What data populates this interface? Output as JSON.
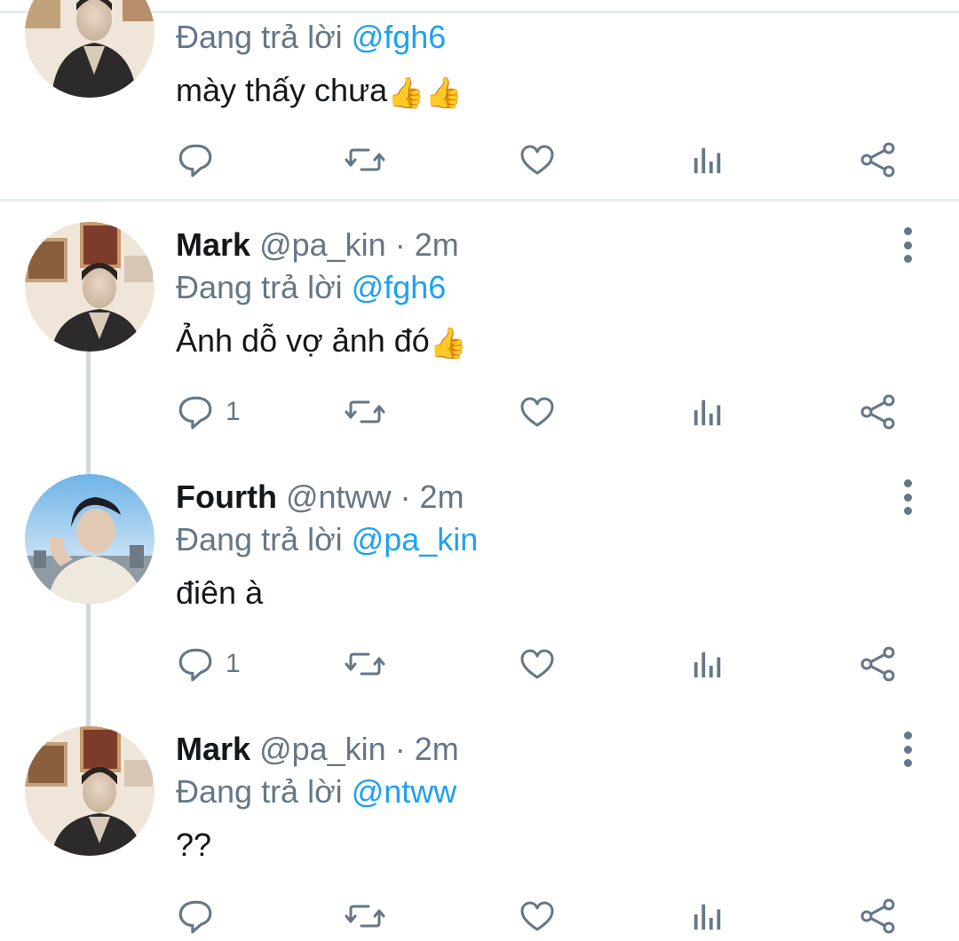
{
  "colors": {
    "accent": "#1da1f2",
    "muted": "#657786",
    "text": "#14171a",
    "line": "#cfd9de"
  },
  "tweets": [
    {
      "reply_prefix": "Đang trả lời ",
      "reply_to": "@fgh6",
      "text": "mày thấy chưa",
      "emoji": "👍👍",
      "reply_count": ""
    },
    {
      "name": "Mark",
      "handle": "@pa_kin",
      "time": " · 2m",
      "reply_prefix": "Đang trả lời ",
      "reply_to": "@fgh6",
      "text": "Ảnh dỗ vợ ảnh đó",
      "emoji": "👍",
      "reply_count": "1"
    },
    {
      "name": "Fourth",
      "handle": "@ntww",
      "time": " · 2m",
      "reply_prefix": "Đang trả lời ",
      "reply_to": "@pa_kin",
      "text": "điên à",
      "emoji": "",
      "reply_count": "1"
    },
    {
      "name": "Mark",
      "handle": "@pa_kin",
      "time": " · 2m",
      "reply_prefix": "Đang trả lời ",
      "reply_to": "@ntww",
      "text": "??",
      "emoji": "",
      "reply_count": ""
    }
  ],
  "icons": [
    "reply-icon",
    "retweet-icon",
    "like-icon",
    "analytics-icon",
    "share-icon",
    "more-icon"
  ]
}
